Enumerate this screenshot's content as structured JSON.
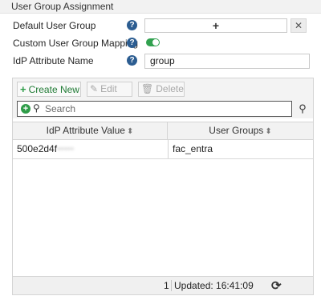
{
  "section": {
    "title": "User Group Assignment"
  },
  "form": {
    "default_group": {
      "label": "Default User Group",
      "select_glyph": "+",
      "clear_glyph": "✕"
    },
    "custom_mapping": {
      "label": "Custom User Group Mapping",
      "enabled": true
    },
    "idp_attribute": {
      "label": "IdP Attribute Name",
      "value": "group"
    },
    "help_glyph": "?"
  },
  "toolbar": {
    "create_label": "Create New",
    "edit_label": "Edit",
    "delete_label": "Delete"
  },
  "search": {
    "placeholder": "Search"
  },
  "table": {
    "columns": [
      "IdP Attribute Value",
      "User Groups"
    ],
    "rows": [
      {
        "idp_value": "500e2d4f",
        "idp_value_redacted": "•••••",
        "user_group": "fac_entra"
      }
    ]
  },
  "status": {
    "count": "1",
    "updated": "Updated: 16:41:09"
  },
  "colors": {
    "accent_green": "#2e9c48",
    "help_blue": "#2c5d91",
    "toggle_on": "#31a14f"
  },
  "icons": [
    "help-icon",
    "plus-icon",
    "close-icon",
    "toggle-icon",
    "edit-icon",
    "delete-icon",
    "add-circle-icon",
    "search-icon",
    "sort-icon",
    "refresh-icon"
  ]
}
